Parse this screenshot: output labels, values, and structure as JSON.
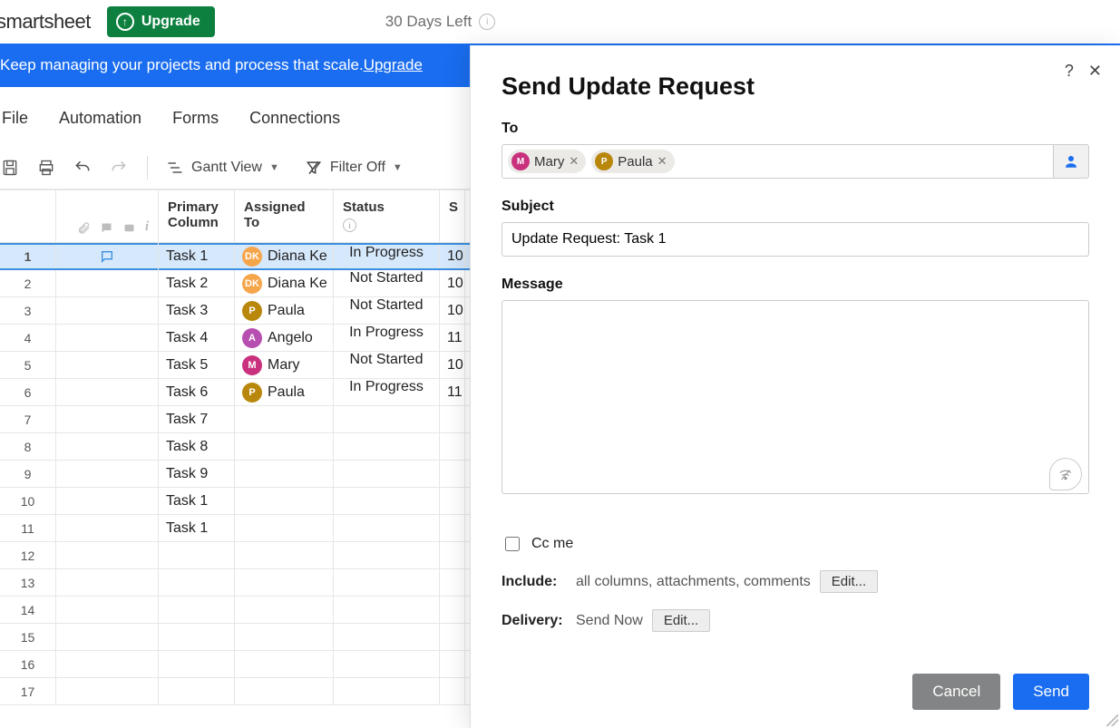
{
  "header": {
    "logo": "smartsheet",
    "upgrade": "Upgrade",
    "trial": "30 Days Left"
  },
  "banner": {
    "text": "Keep managing your projects and process that scale. ",
    "link": "Upgrade"
  },
  "menu": {
    "file": "File",
    "automation": "Automation",
    "forms": "Forms",
    "connections": "Connections"
  },
  "toolbar": {
    "view": "Gantt View",
    "filter": "Filter Off"
  },
  "columns": {
    "primary": "Primary Column",
    "assigned": "Assigned To",
    "status": "Status",
    "s": "S"
  },
  "rows": [
    {
      "n": "1",
      "task": "Task 1",
      "assignee": "Diana Ke",
      "initials": "DK",
      "color": "#f5a54a",
      "status": "In Progress",
      "s": "10",
      "selected": true,
      "comment": true
    },
    {
      "n": "2",
      "task": "Task 2",
      "assignee": "Diana Ke",
      "initials": "DK",
      "color": "#f5a54a",
      "status": "Not Started",
      "s": "10"
    },
    {
      "n": "3",
      "task": "Task 3",
      "assignee": "Paula",
      "initials": "P",
      "color": "#b8870b",
      "status": "Not Started",
      "s": "10"
    },
    {
      "n": "4",
      "task": "Task 4",
      "assignee": "Angelo",
      "initials": "A",
      "color": "#b74fb1",
      "status": "In Progress",
      "s": "11"
    },
    {
      "n": "5",
      "task": "Task 5",
      "assignee": "Mary",
      "initials": "M",
      "color": "#c9317e",
      "status": "Not Started",
      "s": "10"
    },
    {
      "n": "6",
      "task": "Task 6",
      "assignee": "Paula",
      "initials": "P",
      "color": "#b8870b",
      "status": "In Progress",
      "s": "11"
    },
    {
      "n": "7",
      "task": "Task 7"
    },
    {
      "n": "8",
      "task": "Task 8"
    },
    {
      "n": "9",
      "task": "Task 9"
    },
    {
      "n": "10",
      "task": "Task 1"
    },
    {
      "n": "11",
      "task": "Task 1"
    },
    {
      "n": "12",
      "task": ""
    },
    {
      "n": "13",
      "task": ""
    },
    {
      "n": "14",
      "task": ""
    },
    {
      "n": "15",
      "task": ""
    },
    {
      "n": "16",
      "task": ""
    },
    {
      "n": "17",
      "task": ""
    }
  ],
  "modal": {
    "title": "Send Update Request",
    "to_label": "To",
    "chips": [
      {
        "name": "Mary",
        "initials": "M",
        "color": "#c9317e"
      },
      {
        "name": "Paula",
        "initials": "P",
        "color": "#b8870b"
      }
    ],
    "subject_label": "Subject",
    "subject_value": "Update Request: Task 1",
    "message_label": "Message",
    "message_value": "",
    "cc_label": "Cc me",
    "include_label": "Include:",
    "include_value": "all columns, attachments, comments",
    "delivery_label": "Delivery:",
    "delivery_value": "Send Now",
    "edit": "Edit...",
    "cancel": "Cancel",
    "send": "Send"
  }
}
